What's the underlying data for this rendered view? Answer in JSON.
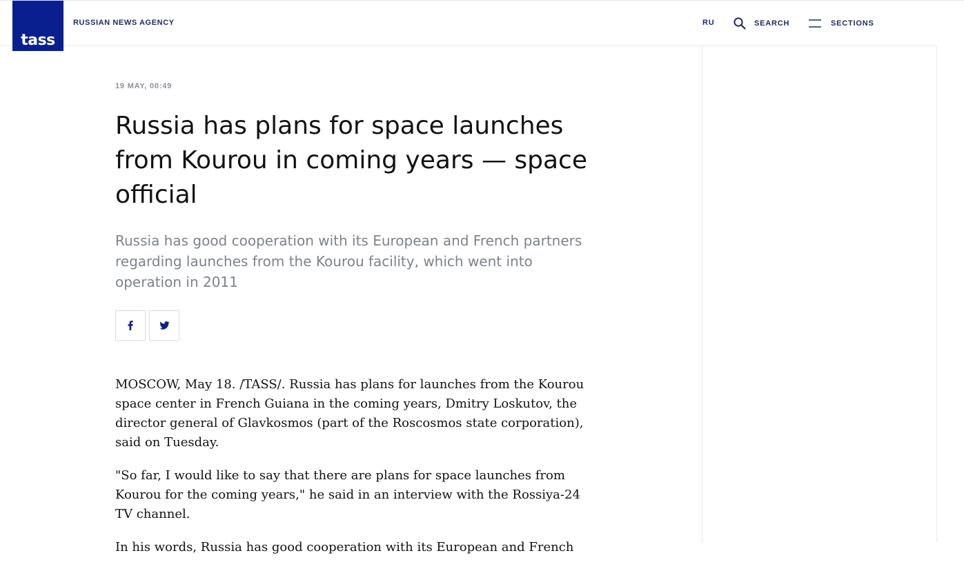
{
  "header": {
    "logo_text": "tass",
    "tagline": "Russian news agency",
    "nav": {
      "ru": "RU",
      "search": "SEARCH",
      "sections": "SECTIONS"
    }
  },
  "article": {
    "date": "19 MAY, 00:49",
    "title": "Russia has plans for space launches from Kourou in coming years — space official",
    "lead": "Russia has good cooperation with its European and French partners regarding launches from the Kourou facility, which went into operation in 2011",
    "share": {
      "facebook_icon": "facebook-icon",
      "twitter_icon": "twitter-icon"
    },
    "paragraphs": [
      "MOSCOW, May 18. /TASS/. Russia has plans for launches from the Kourou space center in French Guiana in the coming years, Dmitry Loskutov, the director general of Glavkosmos (part of the Roscosmos state corporation), said on Tuesday.",
      "\"So far, I would like to say that there are plans for space launches from Kourou for the coming years,\" he said in an interview with the Rossiya-24 TV channel.",
      "In his words, Russia has good cooperation with its European and French"
    ]
  },
  "colors": {
    "brand": "#0a1f8f",
    "nav_text": "#1d2a6b",
    "title": "#121212",
    "lead": "#7d828c",
    "meta": "#8a8f99"
  }
}
